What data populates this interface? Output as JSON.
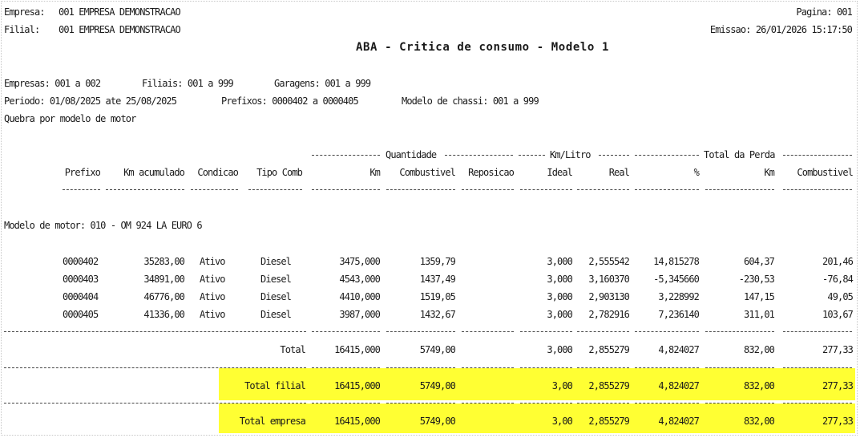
{
  "header": {
    "empresa_label": "Empresa:",
    "empresa_value": "001 EMPRESA DEMONSTRACAO",
    "filial_label": "Filial:",
    "filial_value": "001 EMPRESA DEMONSTRACAO",
    "pagina": "Pagina: 001",
    "emissao": "Emissao: 26/01/2026 15:17:50",
    "title": "ABA - Critica de consumo - Modelo 1"
  },
  "filters": {
    "empresas": "Empresas: 001 a 002",
    "filiais": "Filiais: 001 a 999",
    "garagens": "Garagens: 001 a 999",
    "periodo": "Periodo: 01/08/2025 ate 25/08/2025",
    "prefixos": "Prefixos: 0000402 a 0000405",
    "modelo_chassi": "Modelo de chassi: 001 a 999",
    "quebra": "Quebra por modelo de motor"
  },
  "groups": {
    "quantidade": "Quantidade",
    "kmlitro": "Km/Litro",
    "total_perda": "Total da Perda"
  },
  "columns": {
    "prefixo": "Prefixo",
    "km_acumulado": "Km acumulado",
    "condicao": "Condicao",
    "tipo_comb": "Tipo Comb",
    "km": "Km",
    "combustivel": "Combustivel",
    "reposicao": "Reposicao",
    "ideal": "Ideal",
    "real": "Real",
    "pct": "%",
    "perda_km": "Km",
    "perda_comb": "Combustivel"
  },
  "group_label": "Modelo de motor: 010 - OM 924 LA EURO 6",
  "rows": [
    {
      "prefixo": "0000402",
      "km_acum": "35283,00",
      "condicao": "Ativo",
      "tipo": "Diesel",
      "km": "3475,000",
      "comb": "1359,79",
      "repos": "",
      "ideal": "3,000",
      "real": "2,555542",
      "pct": "14,815278",
      "pkm": "604,37",
      "pcomb": "201,46"
    },
    {
      "prefixo": "0000403",
      "km_acum": "34891,00",
      "condicao": "Ativo",
      "tipo": "Diesel",
      "km": "4543,000",
      "comb": "1437,49",
      "repos": "",
      "ideal": "3,000",
      "real": "3,160370",
      "pct": "-5,345660",
      "pkm": "-230,53",
      "pcomb": "-76,84"
    },
    {
      "prefixo": "0000404",
      "km_acum": "46776,00",
      "condicao": "Ativo",
      "tipo": "Diesel",
      "km": "4410,000",
      "comb": "1519,05",
      "repos": "",
      "ideal": "3,000",
      "real": "2,903130",
      "pct": "3,228992",
      "pkm": "147,15",
      "pcomb": "49,05"
    },
    {
      "prefixo": "0000405",
      "km_acum": "41336,00",
      "condicao": "Ativo",
      "tipo": "Diesel",
      "km": "3987,000",
      "comb": "1432,67",
      "repos": "",
      "ideal": "3,000",
      "real": "2,782916",
      "pct": "7,236140",
      "pkm": "311,01",
      "pcomb": "103,67"
    }
  ],
  "totals": [
    {
      "label": "Total",
      "km": "16415,000",
      "comb": "5749,00",
      "ideal": "3,000",
      "real": "2,855279",
      "pct": "4,824027",
      "pkm": "832,00",
      "pcomb": "277,33"
    },
    {
      "label": "Total filial",
      "km": "16415,000",
      "comb": "5749,00",
      "ideal": "3,00",
      "real": "2,855279",
      "pct": "4,824027",
      "pkm": "832,00",
      "pcomb": "277,33"
    },
    {
      "label": "Total empresa",
      "km": "16415,000",
      "comb": "5749,00",
      "ideal": "3,00",
      "real": "2,855279",
      "pct": "4,824027",
      "pkm": "832,00",
      "pcomb": "277,33"
    }
  ],
  "colors": {
    "highlight": "#ffff33"
  }
}
